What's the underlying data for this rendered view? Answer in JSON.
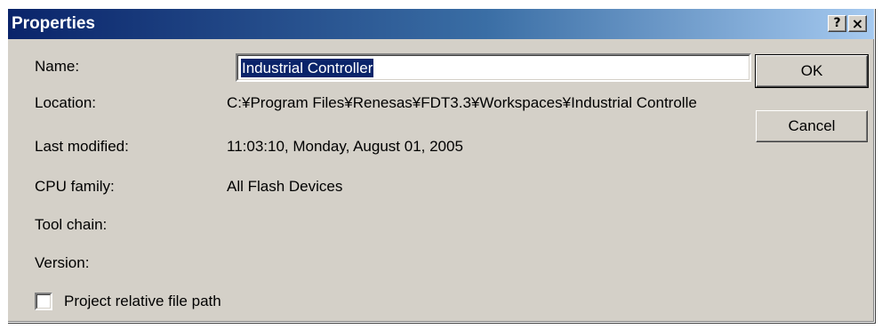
{
  "window": {
    "title": "Properties",
    "help_label": "?",
    "close_label": "×"
  },
  "fields": {
    "name_label": "Name:",
    "name_value": "Industrial Controller",
    "location_label": "Location:",
    "location_value": "C:¥Program Files¥Renesas¥FDT3.3¥Workspaces¥Industrial Controlle",
    "last_modified_label": "Last modified:",
    "last_modified_value": "11:03:10, Monday, August 01, 2005",
    "cpu_family_label": "CPU family:",
    "cpu_family_value": "All Flash Devices",
    "tool_chain_label": "Tool chain:",
    "version_label": "Version:"
  },
  "buttons": {
    "ok_label": "OK",
    "cancel_label": "Cancel"
  },
  "options": {
    "project_relative_label": "Project relative file path",
    "project_relative_checked": false
  }
}
